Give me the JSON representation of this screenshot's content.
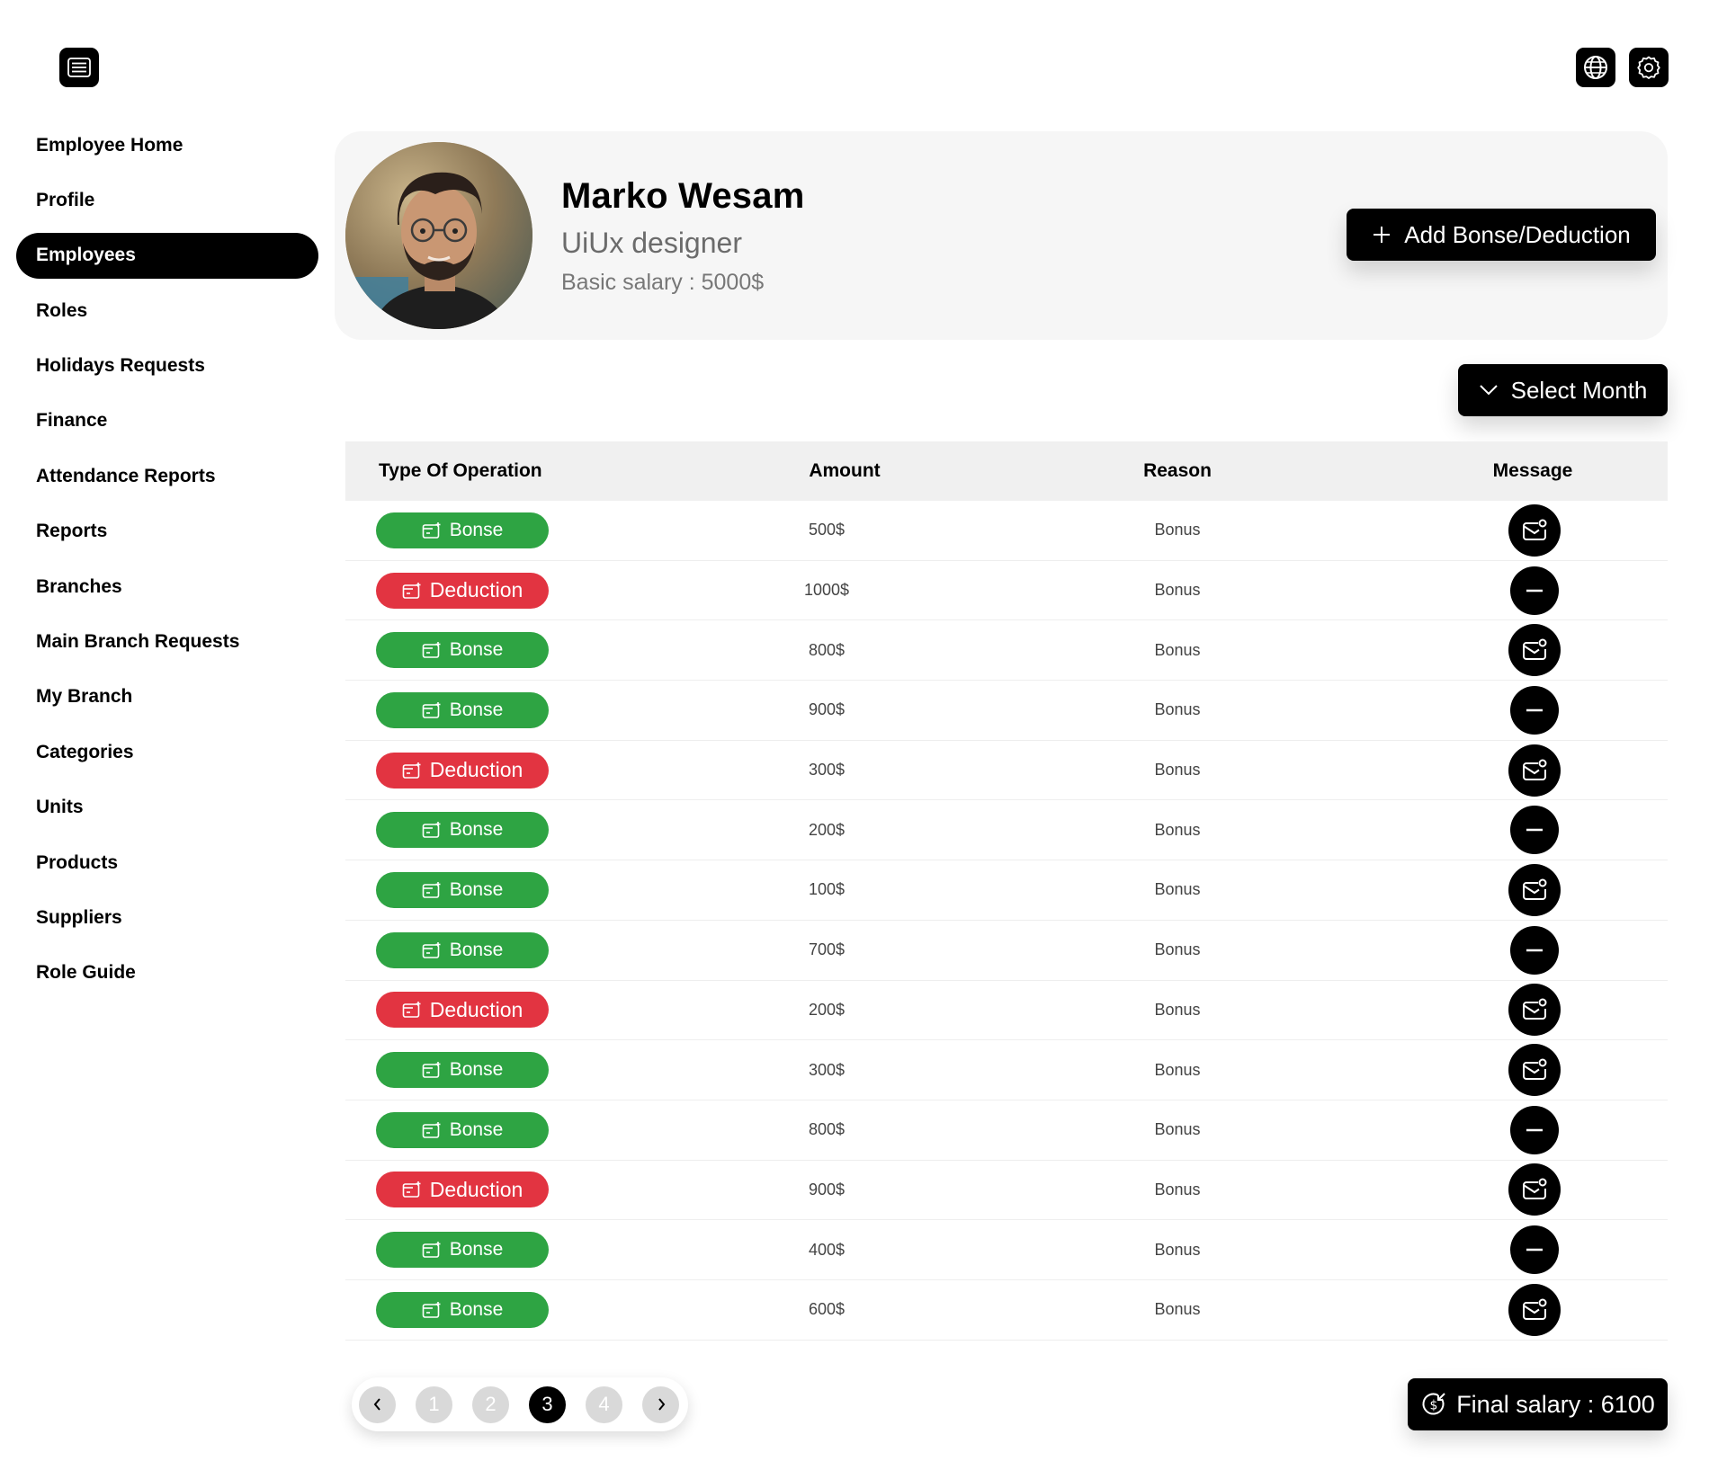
{
  "topbar": {
    "menu_icon": "menu-icon",
    "globe_icon": "globe-icon",
    "settings_icon": "gear-icon"
  },
  "sidebar": {
    "items": [
      {
        "label": "Employee Home",
        "active": false
      },
      {
        "label": "Profile",
        "active": false
      },
      {
        "label": "Employees",
        "active": true
      },
      {
        "label": "Roles",
        "active": false
      },
      {
        "label": "Holidays Requests",
        "active": false
      },
      {
        "label": "Finance",
        "active": false
      },
      {
        "label": "Attendance Reports",
        "active": false
      },
      {
        "label": "Reports",
        "active": false
      },
      {
        "label": "Branches",
        "active": false
      },
      {
        "label": "Main Branch Requests",
        "active": false
      },
      {
        "label": "My Branch",
        "active": false
      },
      {
        "label": "Categories",
        "active": false
      },
      {
        "label": "Units",
        "active": false
      },
      {
        "label": "Products",
        "active": false
      },
      {
        "label": "Suppliers",
        "active": false
      },
      {
        "label": "Role Guide",
        "active": false
      }
    ]
  },
  "profile": {
    "name": "Marko Wesam",
    "role": "UiUx designer",
    "salary": "Basic salary : 5000$",
    "add_button_label": "Add Bonse/Deduction"
  },
  "filters": {
    "month_button_label": "Select Month"
  },
  "table": {
    "headers": [
      "Type Of Operation",
      "Amount",
      "Reason",
      "Message"
    ],
    "rows": [
      {
        "type": "Bonse",
        "amount": "500$",
        "reason": "Bonus",
        "message": "mail"
      },
      {
        "type": "Deduction",
        "amount": "1000$",
        "reason": "Bonus",
        "message": "none"
      },
      {
        "type": "Bonse",
        "amount": "800$",
        "reason": "Bonus",
        "message": "mail"
      },
      {
        "type": "Bonse",
        "amount": "900$",
        "reason": "Bonus",
        "message": "none"
      },
      {
        "type": "Deduction",
        "amount": "300$",
        "reason": "Bonus",
        "message": "mail"
      },
      {
        "type": "Bonse",
        "amount": "200$",
        "reason": "Bonus",
        "message": "none"
      },
      {
        "type": "Bonse",
        "amount": "100$",
        "reason": "Bonus",
        "message": "mail"
      },
      {
        "type": "Bonse",
        "amount": "700$",
        "reason": "Bonus",
        "message": "none"
      },
      {
        "type": "Deduction",
        "amount": "200$",
        "reason": "Bonus",
        "message": "mail"
      },
      {
        "type": "Bonse",
        "amount": "300$",
        "reason": "Bonus",
        "message": "mail"
      },
      {
        "type": "Bonse",
        "amount": "800$",
        "reason": "Bonus",
        "message": "none"
      },
      {
        "type": "Deduction",
        "amount": "900$",
        "reason": "Bonus",
        "message": "mail"
      },
      {
        "type": "Bonse",
        "amount": "400$",
        "reason": "Bonus",
        "message": "none"
      },
      {
        "type": "Bonse",
        "amount": "600$",
        "reason": "Bonus",
        "message": "mail"
      }
    ]
  },
  "pagination": {
    "pages": [
      "1",
      "2",
      "3",
      "4"
    ],
    "current": "3"
  },
  "summary": {
    "final_salary": "Final salary : 6100"
  },
  "colors": {
    "bonse": "#2ea443",
    "deduction": "#e23441",
    "primary": "#000000",
    "card_bg": "#f6f6f6"
  }
}
